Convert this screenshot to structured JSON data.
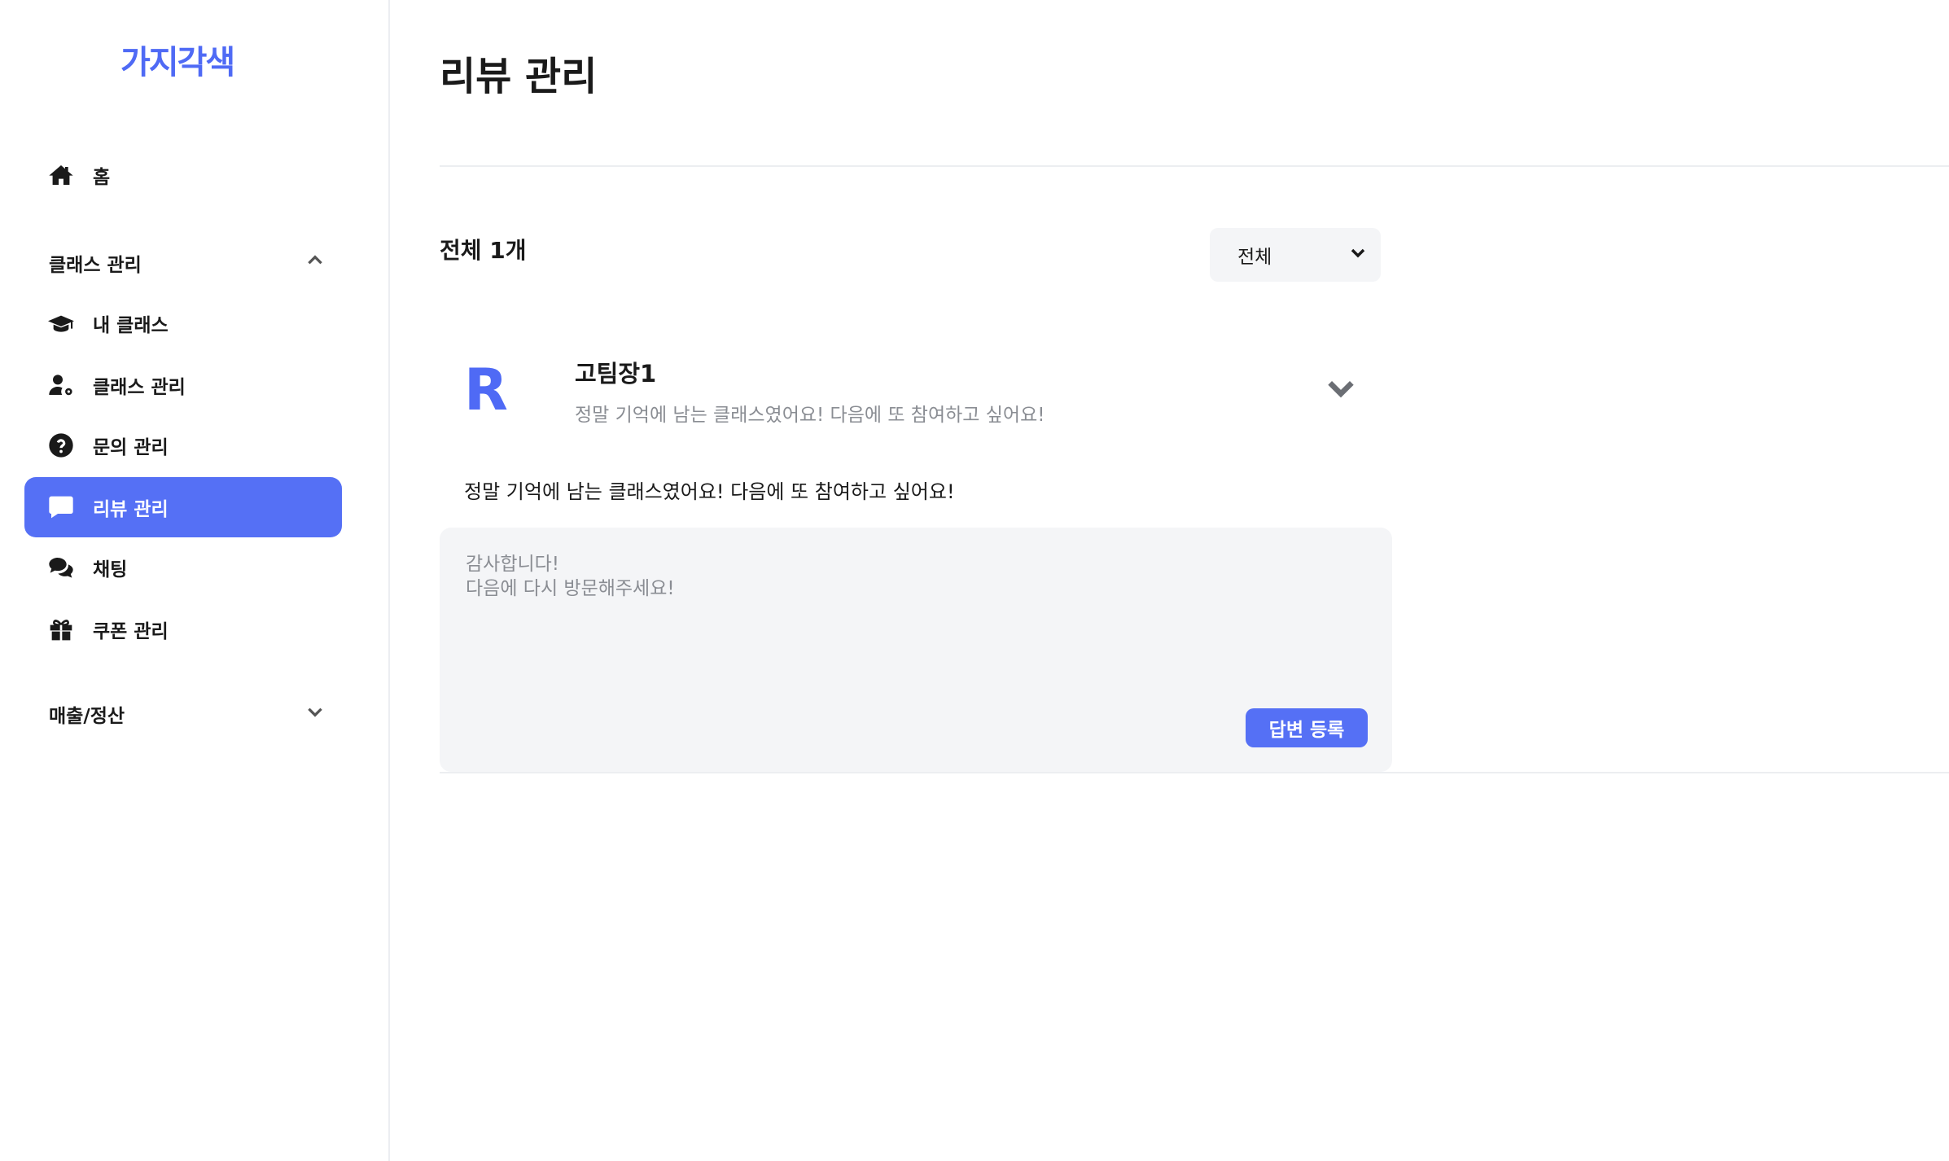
{
  "app": {
    "logo": "가지각색"
  },
  "sidebar": {
    "home": {
      "label": "홈",
      "icon": "home-icon"
    },
    "class_group": {
      "label": "클래스 관리",
      "icon": "chevron-up-icon"
    },
    "items": [
      {
        "label": "내 클래스",
        "icon": "graduation-cap-icon"
      },
      {
        "label": "클래스 관리",
        "icon": "user-gear-icon"
      },
      {
        "label": "문의 관리",
        "icon": "question-circle-icon"
      },
      {
        "label": "리뷰 관리",
        "icon": "comment-icon",
        "active": true
      },
      {
        "label": "채팅",
        "icon": "comments-icon"
      },
      {
        "label": "쿠폰 관리",
        "icon": "gift-icon"
      }
    ],
    "sales_group": {
      "label": "매출/정산",
      "icon": "chevron-down-icon"
    }
  },
  "main": {
    "title": "리뷰 관리",
    "count_label": "전체 1개",
    "filter": {
      "selected": "전체"
    },
    "review": {
      "avatar_letter": "R",
      "reviewer": "고팀장1",
      "preview": "정말 기억에 남는 클래스였어요! 다음에 또 참여하고 싶어요!",
      "full_text": "정말 기억에 남는 클래스였어요! 다음에 또 참여하고 싶어요!",
      "reply_value": "감사합니다!\n다음에 다시 방문해주세요!",
      "submit_label": "답변 등록"
    }
  },
  "colors": {
    "accent": "#5570f5",
    "logo": "#4f6af5",
    "muted": "#8a8d93",
    "panel": "#f4f5f7"
  }
}
